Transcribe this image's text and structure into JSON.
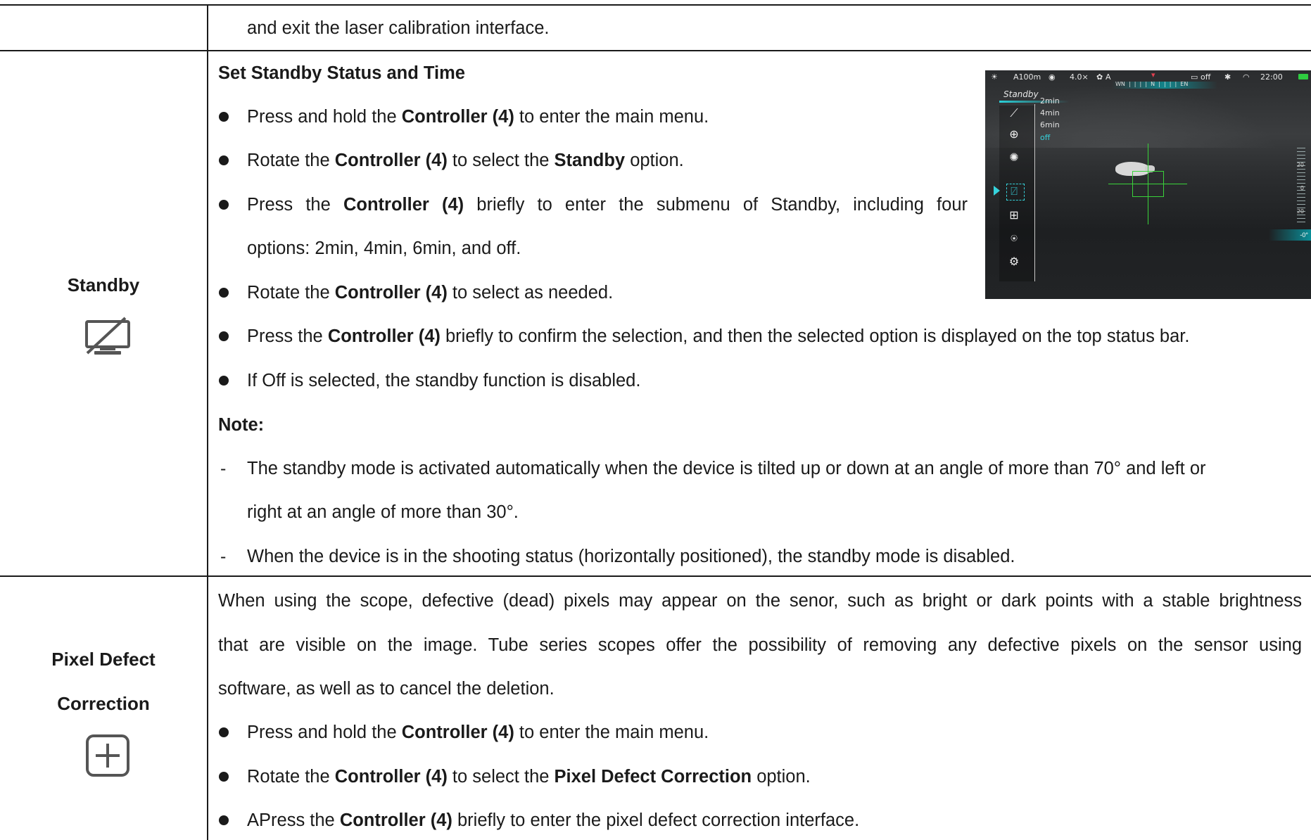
{
  "row_continued": {
    "text": "and exit the laser calibration interface."
  },
  "standby": {
    "label": "Standby",
    "icon": "standby-monitor-icon",
    "heading": "Set Standby Status and Time",
    "bullets": [
      {
        "pre": "Press and hold the ",
        "b1": "Controller (4)",
        "post": " to enter the main menu."
      },
      {
        "pre": "Rotate the ",
        "b1": "Controller (4)",
        "mid": " to select the ",
        "b2": "Standby",
        "post": " option."
      },
      {
        "pre": "Press the ",
        "b1": "Controller (4)",
        "post": " briefly to enter the submenu of Standby, including four",
        "cont": "options: 2min, 4min, 6min, and off."
      },
      {
        "pre": "Rotate the ",
        "b1": "Controller (4)",
        "post": " to select as needed."
      },
      {
        "pre": "Press the ",
        "b1": "Controller (4)",
        "post": " briefly to confirm the selection, and then the selected option is displayed on the top status bar."
      },
      {
        "pre": "If Off is selected, the standby function is disabled."
      }
    ],
    "note_label": "Note:",
    "notes": [
      {
        "dash": "-",
        "line1": "The standby mode is activated automatically when the device is tilted up or down at an angle of more than 70° and left or",
        "line2": "right at an angle of more than 30°."
      },
      {
        "dash": "-",
        "line1": "When the device is in the shooting status (horizontally positioned), the standby mode is disabled."
      }
    ],
    "screen": {
      "status": {
        "range": "A100m",
        "zoom": "4.0×",
        "mode": "A",
        "standby": "off",
        "time": "22:00",
        "compass": "WN  |  |  |  |  N  |  |  |  |  EN"
      },
      "menu_title": "Standby",
      "options": [
        "2min",
        "4min",
        "6min",
        "off"
      ],
      "selected_option": "off",
      "scale_labels": [
        "20",
        "0",
        "20"
      ],
      "angle": "-0°",
      "colors": {
        "accent": "#36d3dc",
        "reticle": "#3ad33a",
        "battery": "#2ecc40"
      },
      "menu_icons": [
        "rifle-icon",
        "crosshair-icon",
        "brightness-icon",
        "standby-icon",
        "pixel-defect-icon",
        "navigation-icon",
        "settings-gear-icon"
      ]
    }
  },
  "pixel_defect": {
    "label_line1": "Pixel Defect",
    "label_line2": "Correction",
    "icon": "plus-square-icon",
    "intro_lines": [
      "When using the scope, defective (dead) pixels may appear on the senor, such as bright or dark points with a stable brightness",
      "that are visible on the image. Tube series scopes offer the possibility of removing any defective pixels on the sensor using",
      "software, as well as to cancel the deletion."
    ],
    "bullets": [
      {
        "pre": "Press and hold the ",
        "b1": "Controller (4)",
        "post": " to enter the main menu."
      },
      {
        "pre": "Rotate the ",
        "b1": "Controller (4)",
        "mid": " to select the ",
        "b2": "Pixel Defect Correction",
        "post": " option."
      },
      {
        "pre": "APress the ",
        "b1": "Controller (4)",
        "post": " briefly to enter the pixel defect correction interface."
      }
    ]
  }
}
